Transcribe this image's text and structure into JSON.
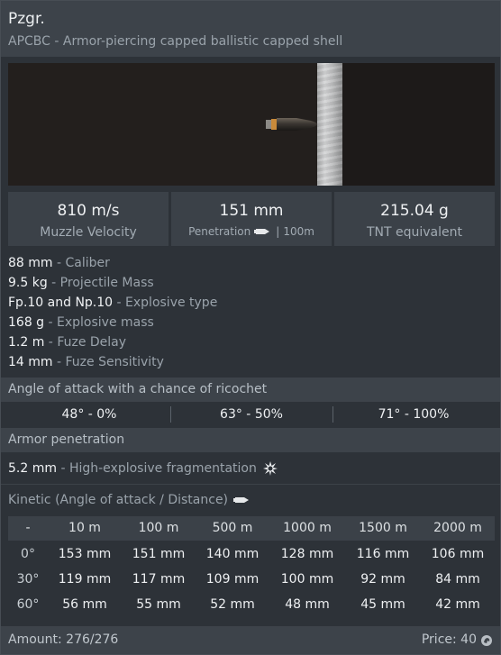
{
  "header": {
    "title": "Pzgr.",
    "subtitle": "APCBC - Armor-piercing capped ballistic capped shell"
  },
  "stats": {
    "velocity": {
      "value": "810 m/s",
      "label": "Muzzle Velocity"
    },
    "penetration": {
      "value": "151 mm",
      "label": "Penetration",
      "distance": "100m"
    },
    "tnt": {
      "value": "215.04 g",
      "label": "TNT equivalent"
    }
  },
  "properties": [
    {
      "value": "88 mm",
      "desc": "Caliber"
    },
    {
      "value": "9.5 kg",
      "desc": "Projectile Mass"
    },
    {
      "value": "Fp.10 and Np.10",
      "desc": "Explosive type"
    },
    {
      "value": "168 g",
      "desc": "Explosive mass"
    },
    {
      "value": "1.2 m",
      "desc": "Fuze Delay"
    },
    {
      "value": "14 mm",
      "desc": "Fuze Sensitivity"
    }
  ],
  "ricochet": {
    "title": "Angle of attack with a chance of ricochet",
    "values": [
      "48° - 0%",
      "63° - 50%",
      "71° - 100%"
    ]
  },
  "armor": {
    "title": "Armor penetration",
    "he_value": "5.2 mm",
    "he_desc": "High-explosive fragmentation",
    "he_icon": "explosion-icon"
  },
  "kinetic": {
    "title": "Kinetic (Angle of attack / Distance)",
    "icon": "shell-icon",
    "corner": "-",
    "columns": [
      "10 m",
      "100 m",
      "500 m",
      "1000 m",
      "1500 m",
      "2000 m"
    ],
    "rows": [
      {
        "angle": "0°",
        "values": [
          "153 mm",
          "151 mm",
          "140 mm",
          "128 mm",
          "116 mm",
          "106 mm"
        ]
      },
      {
        "angle": "30°",
        "values": [
          "119 mm",
          "117 mm",
          "109 mm",
          "100 mm",
          "92 mm",
          "84 mm"
        ]
      },
      {
        "angle": "60°",
        "values": [
          "56 mm",
          "55 mm",
          "52 mm",
          "48 mm",
          "45 mm",
          "42 mm"
        ]
      }
    ]
  },
  "footer": {
    "amount": "Amount: 276/276",
    "price": "Price: 40",
    "price_icon": "silver-lions-icon"
  }
}
